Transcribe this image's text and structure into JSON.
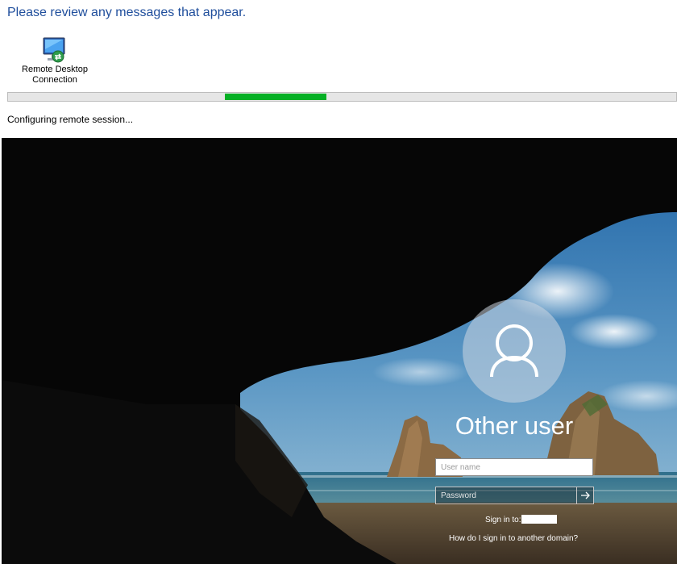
{
  "dialog": {
    "message": "Please review any messages that appear.",
    "app_icon": "remote-desktop-icon",
    "app_label_line1": "Remote Desktop",
    "app_label_line2": "Connection",
    "progress": {
      "start_fraction": 0.325,
      "end_fraction": 0.477
    },
    "status": "Configuring remote session..."
  },
  "login": {
    "avatar_icon": "user-icon",
    "title": "Other user",
    "username_placeholder": "User name",
    "password_placeholder": "Password",
    "submit_icon": "arrow-right-icon",
    "sign_in_to": "Sign in to:",
    "other_domain_link": "How do I sign in to another domain?"
  },
  "colors": {
    "message": "#1f4e9c",
    "progress": "#06b025",
    "screen_bg": "#050505"
  }
}
